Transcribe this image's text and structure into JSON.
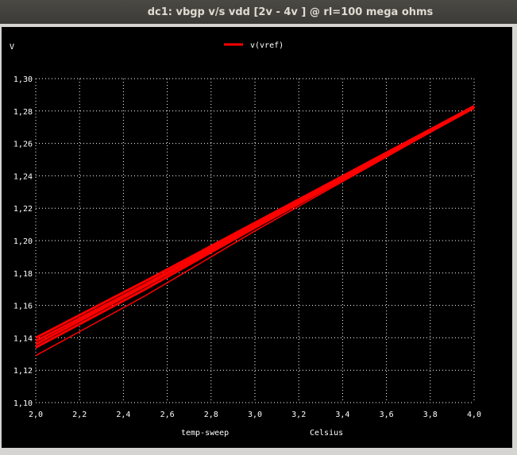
{
  "window": {
    "title": "dc1: vbgp v/s vdd [2v - 4v ] @ rl=100 mega ohms"
  },
  "colors": {
    "background": "#000000",
    "grid": "#ffffff",
    "trace": "#ff0000",
    "text": "#ffffff"
  },
  "chart_data": {
    "type": "line",
    "ylabel": "V",
    "xlabel": "temp-sweep",
    "xunit": "Celsius",
    "xlim": [
      2.0,
      4.0
    ],
    "ylim": [
      1.1,
      1.3
    ],
    "xticks": [
      "2,0",
      "2,2",
      "2,4",
      "2,6",
      "2,8",
      "3,0",
      "3,2",
      "3,4",
      "3,6",
      "3,8",
      "4,0"
    ],
    "yticks": [
      "1,10",
      "1,12",
      "1,14",
      "1,16",
      "1,18",
      "1,20",
      "1,22",
      "1,24",
      "1,26",
      "1,28",
      "1,30"
    ],
    "grid": true,
    "grid_style": "dotted",
    "legend": {
      "placement": "top-center",
      "entries": [
        {
          "label": "v(vref)",
          "color": "#ff0000"
        }
      ]
    },
    "series": [
      {
        "name": "v(vref)",
        "x": [
          2.0,
          2.5,
          3.0,
          3.5,
          4.0
        ],
        "values": [
          1.14,
          1.175,
          1.211,
          1.247,
          1.283
        ]
      },
      {
        "x": [
          2.0,
          2.5,
          3.0,
          3.5,
          4.0
        ],
        "values": [
          1.138,
          1.173,
          1.21,
          1.246,
          1.283
        ]
      },
      {
        "x": [
          2.0,
          2.5,
          3.0,
          3.5,
          4.0
        ],
        "values": [
          1.136,
          1.172,
          1.209,
          1.245,
          1.282
        ]
      },
      {
        "x": [
          2.0,
          2.5,
          3.0,
          3.5,
          4.0
        ],
        "values": [
          1.134,
          1.17,
          1.208,
          1.245,
          1.282
        ]
      },
      {
        "x": [
          2.0,
          2.5,
          3.0,
          3.5,
          4.0
        ],
        "values": [
          1.129,
          1.166,
          1.206,
          1.244,
          1.282
        ]
      }
    ]
  }
}
